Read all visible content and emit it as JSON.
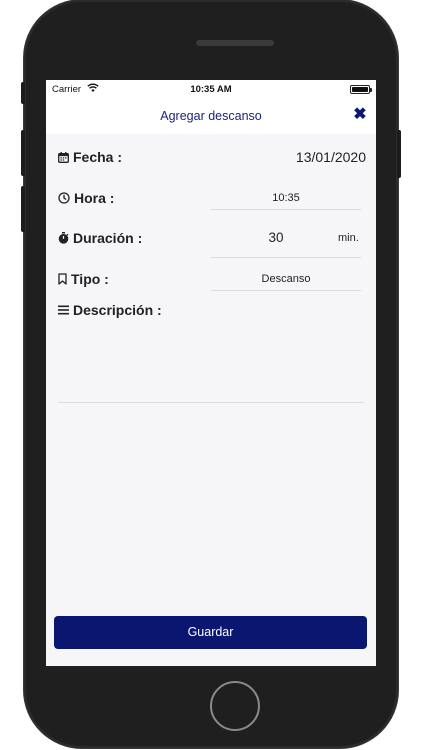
{
  "status_bar": {
    "carrier": "Carrier",
    "time": "10:35 AM"
  },
  "nav": {
    "title": "Agregar descanso",
    "close_icon": "close-icon"
  },
  "form": {
    "fecha": {
      "label": "Fecha :",
      "value": "13/01/2020",
      "icon": "calendar-icon"
    },
    "hora": {
      "label": "Hora :",
      "value": "10:35",
      "icon": "clock-icon"
    },
    "duracion": {
      "label": "Duración :",
      "value": "30",
      "unit": "min.",
      "icon": "stopwatch-icon"
    },
    "tipo": {
      "label": "Tipo :",
      "value": "Descanso",
      "icon": "bookmark-icon"
    },
    "descripcion": {
      "label": "Descripción :",
      "value": "",
      "icon": "list-icon"
    }
  },
  "actions": {
    "save_label": "Guardar"
  },
  "colors": {
    "primary": "#0a1670",
    "title": "#1a237e",
    "background": "#f6f6f9"
  }
}
